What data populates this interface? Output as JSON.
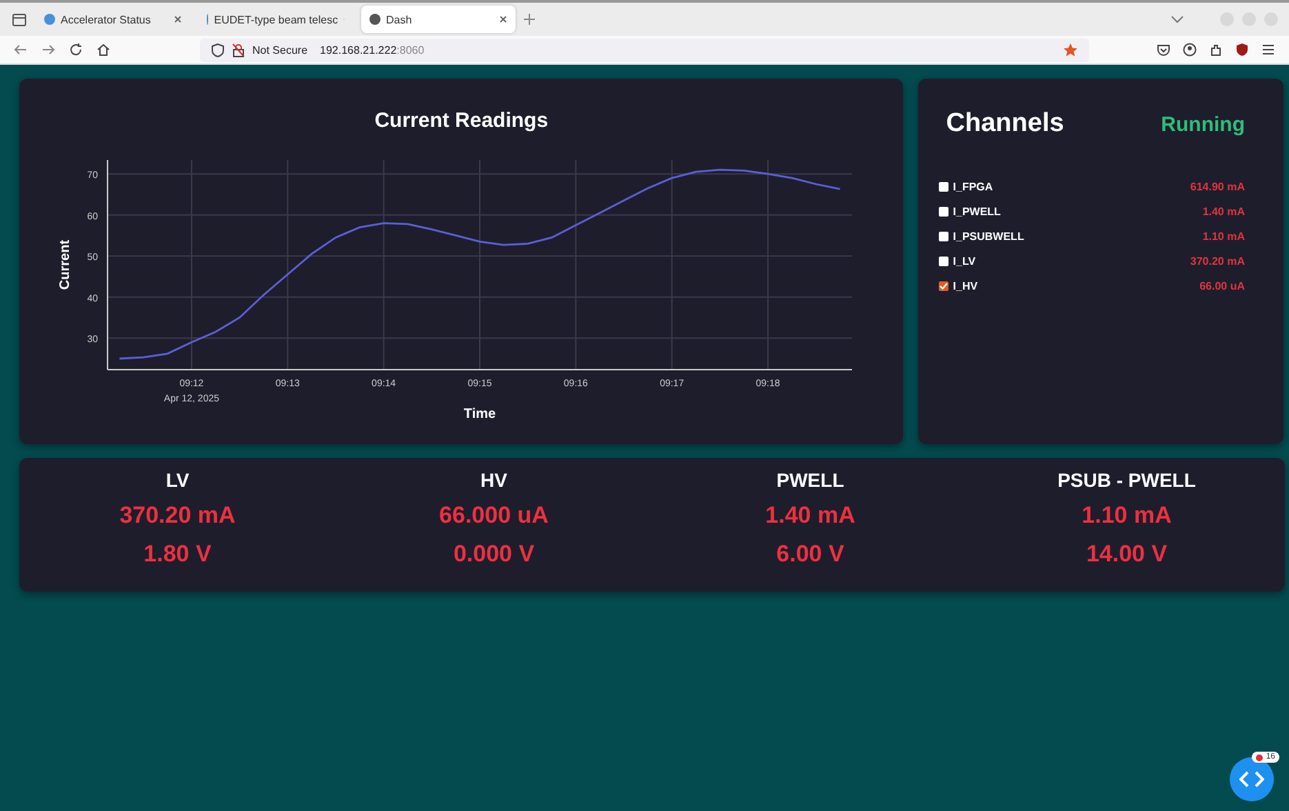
{
  "browser": {
    "tabs": [
      {
        "title": "Accelerator Status",
        "selected": false
      },
      {
        "title": "EUDET-type beam telesc",
        "selected": false
      },
      {
        "title": "Dash",
        "selected": true
      }
    ],
    "security": "Not Secure",
    "url_host": "192.168.21.222",
    "url_port": ":8060",
    "bookmarked": true
  },
  "readings": {
    "title": "Current Readings",
    "chart_data": {
      "type": "line",
      "xlabel": "Time",
      "ylabel": "Current",
      "categories": [
        null,
        null,
        null,
        "09:12",
        null,
        null,
        null,
        "09:13",
        null,
        null,
        null,
        "09:14",
        null,
        null,
        null,
        "09:15",
        null,
        null,
        null,
        "09:16",
        null,
        null,
        null,
        "09:17",
        null,
        null,
        null,
        "09:18",
        null,
        null,
        null
      ],
      "series": [
        {
          "color": "#5a5fd6",
          "values": [
            25.0,
            25.3,
            26.2,
            29,
            31.5,
            35,
            40.5,
            45.5,
            50.5,
            54.5,
            57,
            58,
            57.8,
            56.5,
            55,
            53.5,
            52.7,
            53,
            54.5,
            57.5,
            60.5,
            63.5,
            66.5,
            69,
            70.5,
            71,
            70.8,
            70,
            69,
            67.5,
            66.3
          ]
        }
      ],
      "ylim": [
        22.3,
        73.4
      ],
      "grid": true,
      "yticks": [
        30,
        40,
        50,
        60,
        70
      ]
    },
    "date_label": "Apr 12, 2025"
  },
  "channels": {
    "title": "Channels",
    "status": "Running",
    "items": [
      {
        "name": "I_FPGA",
        "checked": false,
        "value": "614.90 mA"
      },
      {
        "name": "I_PWELL",
        "checked": false,
        "value": "1.40 mA"
      },
      {
        "name": "I_PSUBWELL",
        "checked": false,
        "value": "1.10 mA"
      },
      {
        "name": "I_LV",
        "checked": false,
        "value": "370.20 mA"
      },
      {
        "name": "I_HV",
        "checked": true,
        "value": "66.00 uA"
      }
    ]
  },
  "supplies": [
    {
      "name": "LV",
      "current": "370.20 mA",
      "voltage": "1.80 V"
    },
    {
      "name": "HV",
      "current": "66.000 uA",
      "voltage": "0.000 V"
    },
    {
      "name": "PWELL",
      "current": "1.40 mA",
      "voltage": "6.00 V"
    },
    {
      "name": "PSUB - PWELL",
      "current": "1.10 mA",
      "voltage": "14.00 V"
    }
  ],
  "debug_badge": "16"
}
